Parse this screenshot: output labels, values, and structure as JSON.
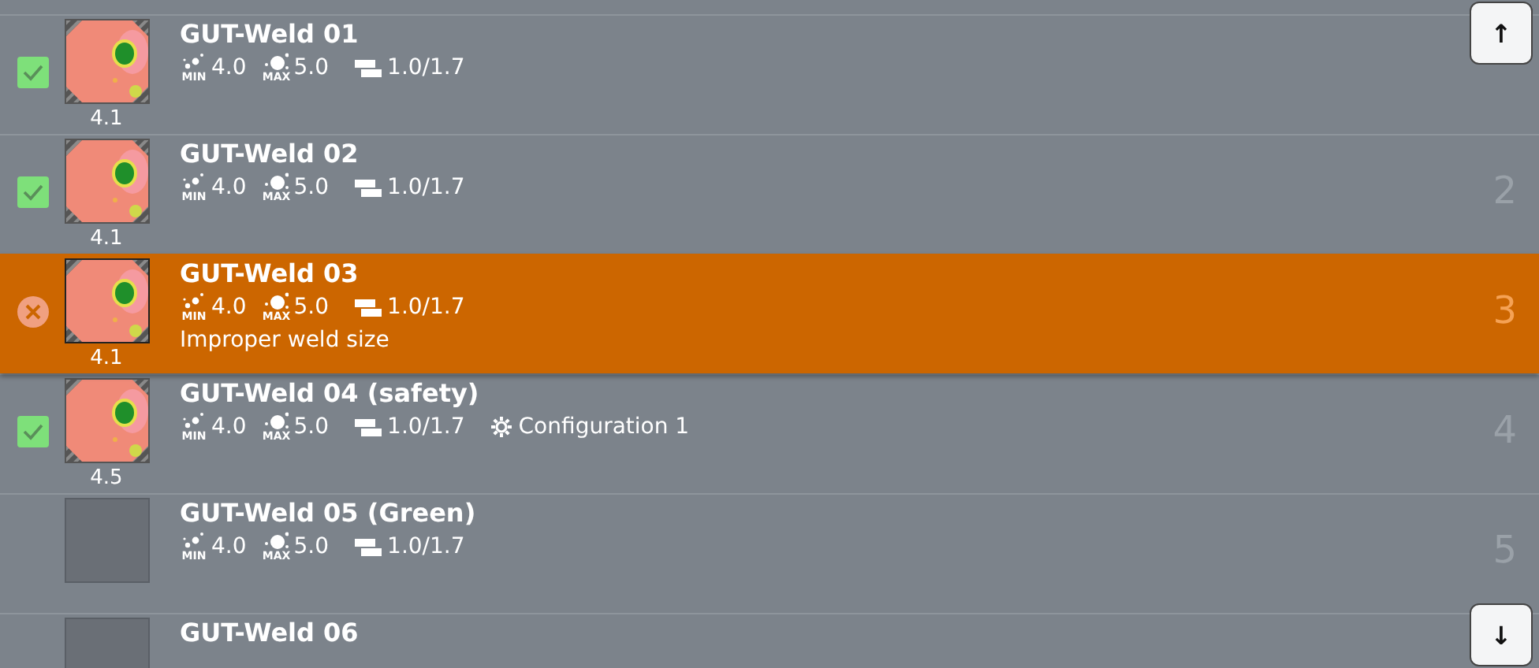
{
  "welds": [
    {
      "name": "GUT-Weld 01",
      "checked": true,
      "has_image": true,
      "score": "4.1",
      "min_label": "MIN",
      "min": "4.0",
      "max_label": "MAX",
      "max": "5.0",
      "thickness": "1.0/1.7",
      "selected": false
    },
    {
      "name": "GUT-Weld 02",
      "checked": true,
      "has_image": true,
      "score": "4.1",
      "min_label": "MIN",
      "min": "4.0",
      "max_label": "MAX",
      "max": "5.0",
      "thickness": "1.0/1.7",
      "number": "2",
      "selected": false
    },
    {
      "name": "GUT-Weld 03",
      "error": true,
      "has_image": true,
      "score": "4.1",
      "min_label": "MIN",
      "min": "4.0",
      "max_label": "MAX",
      "max": "5.0",
      "thickness": "1.0/1.7",
      "message": "Improper weld size",
      "number": "3",
      "selected": true
    },
    {
      "name": "GUT-Weld 04 (safety)",
      "checked": true,
      "has_image": true,
      "score": "4.5",
      "min_label": "MIN",
      "min": "4.0",
      "max_label": "MAX",
      "max": "5.0",
      "thickness": "1.0/1.7",
      "configuration": "Configuration 1",
      "number": "4",
      "selected": false
    },
    {
      "name": "GUT-Weld 05 (Green)",
      "checked": false,
      "has_image": false,
      "min_label": "MIN",
      "min": "4.0",
      "max_label": "MAX",
      "max": "5.0",
      "thickness": "1.0/1.7",
      "number": "5",
      "selected": false
    },
    {
      "name": "GUT-Weld 06",
      "checked": false,
      "has_image": false,
      "selected": false
    }
  ],
  "scroll_buttons": [
    {
      "label": "↑"
    },
    {
      "label": "↓"
    }
  ]
}
